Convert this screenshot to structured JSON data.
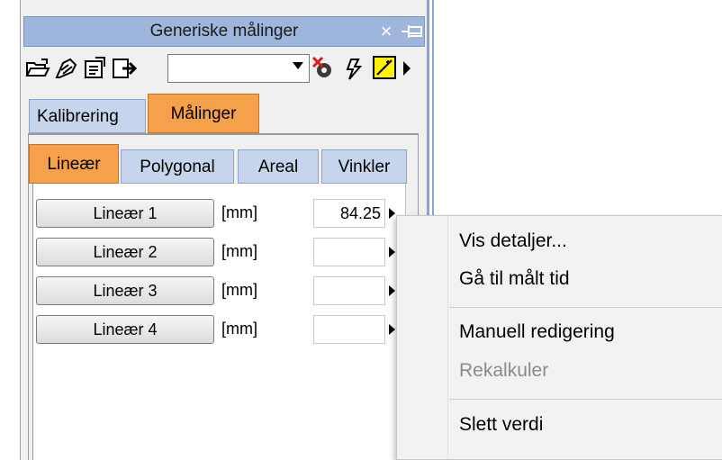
{
  "panel": {
    "title": "Generiske målinger",
    "close_symbol": "×",
    "pin_icon": "pin-icon"
  },
  "toolbar": {
    "icons": [
      "open-folder-icon",
      "edit-measure-icon",
      "edit-measure-2-icon",
      "export-icon",
      "delete-eye-icon",
      "run-icon",
      "auto-draw-icon",
      "play-arrow-icon"
    ],
    "dropdown_value": ""
  },
  "tabs": [
    {
      "label": "Kalibrering",
      "active": false
    },
    {
      "label": "Målinger",
      "active": true
    }
  ],
  "subtabs": [
    {
      "label": "Lineær",
      "active": true
    },
    {
      "label": "Polygonal",
      "active": false
    },
    {
      "label": "Areal",
      "active": false
    },
    {
      "label": "Vinkler",
      "active": false
    }
  ],
  "measurements": [
    {
      "label": "Lineær 1",
      "unit": "[mm]",
      "value": "84.25"
    },
    {
      "label": "Lineær 2",
      "unit": "[mm]",
      "value": ""
    },
    {
      "label": "Lineær 3",
      "unit": "[mm]",
      "value": ""
    },
    {
      "label": "Lineær 4",
      "unit": "[mm]",
      "value": ""
    }
  ],
  "context_menu": {
    "items": [
      {
        "label": "Vis detaljer...",
        "enabled": true
      },
      {
        "label": "Gå til målt tid",
        "enabled": true
      },
      {
        "label": "Manuell redigering",
        "enabled": true
      },
      {
        "label": "Rekalkuler",
        "enabled": false
      },
      {
        "label": "Slett verdi",
        "enabled": true
      }
    ]
  },
  "colors": {
    "title_bar": "#9fb6dc",
    "active_tab": "#f5a04a",
    "inactive_tab": "#c7d5ec",
    "disabled_text": "#8a8a8a"
  }
}
